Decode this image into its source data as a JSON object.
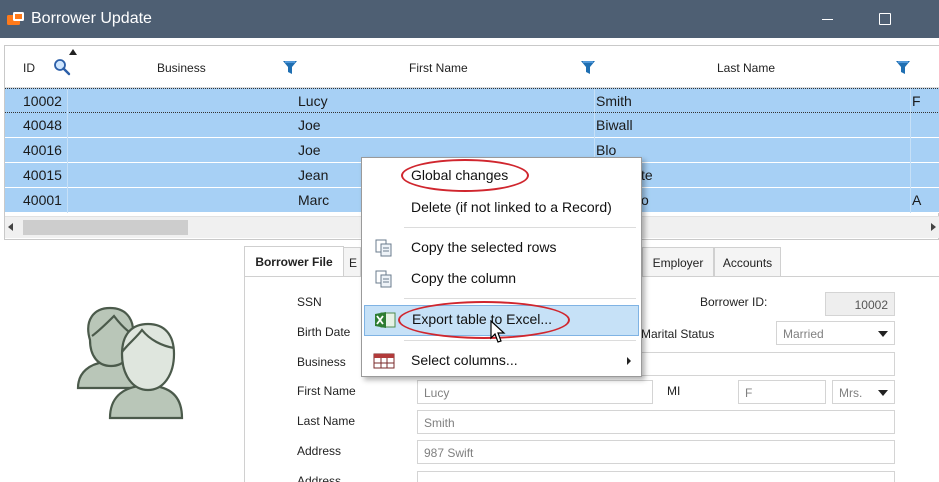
{
  "window": {
    "title": "Borrower Update"
  },
  "grid": {
    "headers": {
      "id": "ID",
      "business": "Business",
      "first_name": "First Name",
      "last_name": "Last Name"
    },
    "rows": [
      {
        "id": "10002",
        "business": "",
        "first_name": "Lucy",
        "last_name": "Smith",
        "extra": "F"
      },
      {
        "id": "40048",
        "business": "",
        "first_name": "Joe",
        "last_name": "Biwall",
        "extra": ""
      },
      {
        "id": "40016",
        "business": "",
        "first_name": "Joe",
        "last_name": "Blo",
        "extra": ""
      },
      {
        "id": "40015",
        "business": "",
        "first_name": "Jean",
        "last_name": "te",
        "extra": ""
      },
      {
        "id": "40001",
        "business": "",
        "first_name": "Marc",
        "last_name": "o",
        "extra": "A"
      }
    ]
  },
  "tabs": [
    {
      "label": "Borrower File"
    },
    {
      "label": "E"
    },
    {
      "label": "Employer"
    },
    {
      "label": "Accounts"
    }
  ],
  "form": {
    "ssn_label": "SSN",
    "birth_date_label": "Birth Date",
    "business_label": "Business",
    "first_name_label": "First Name",
    "last_name_label": "Last Name",
    "address_label": "Address",
    "address2_label": "Address",
    "borrower_id_label": "Borrower ID:",
    "borrower_id_value": "10002",
    "marital_status_label": "Marital Status",
    "marital_status_value": "Married",
    "mi_label": "MI",
    "first_name_value": "Lucy",
    "mi_value": "F",
    "title_value": "Mrs.",
    "last_name_value": "Smith",
    "address_value": "987 Swift"
  },
  "context_menu": {
    "items": [
      {
        "label": "Global changes"
      },
      {
        "label": "Delete (if not linked to a Record)"
      },
      {
        "label": "Copy the selected rows"
      },
      {
        "label": "Copy the column"
      },
      {
        "label": "Export table to Excel..."
      },
      {
        "label": "Select columns..."
      }
    ]
  },
  "colors": {
    "titlebar": "#4e5f73",
    "row_selected": "#a7d0f5",
    "menu_hover": "#c6e1f7",
    "highlight_oval": "#d0262e",
    "filter_icon": "#1f6fb2"
  },
  "icons": {
    "app": "app-icon",
    "search": "search-icon",
    "filter": "filter-icon",
    "copy": "copy-icon",
    "excel": "excel-icon",
    "columns": "columns-icon",
    "avatar": "users-avatar-icon"
  }
}
